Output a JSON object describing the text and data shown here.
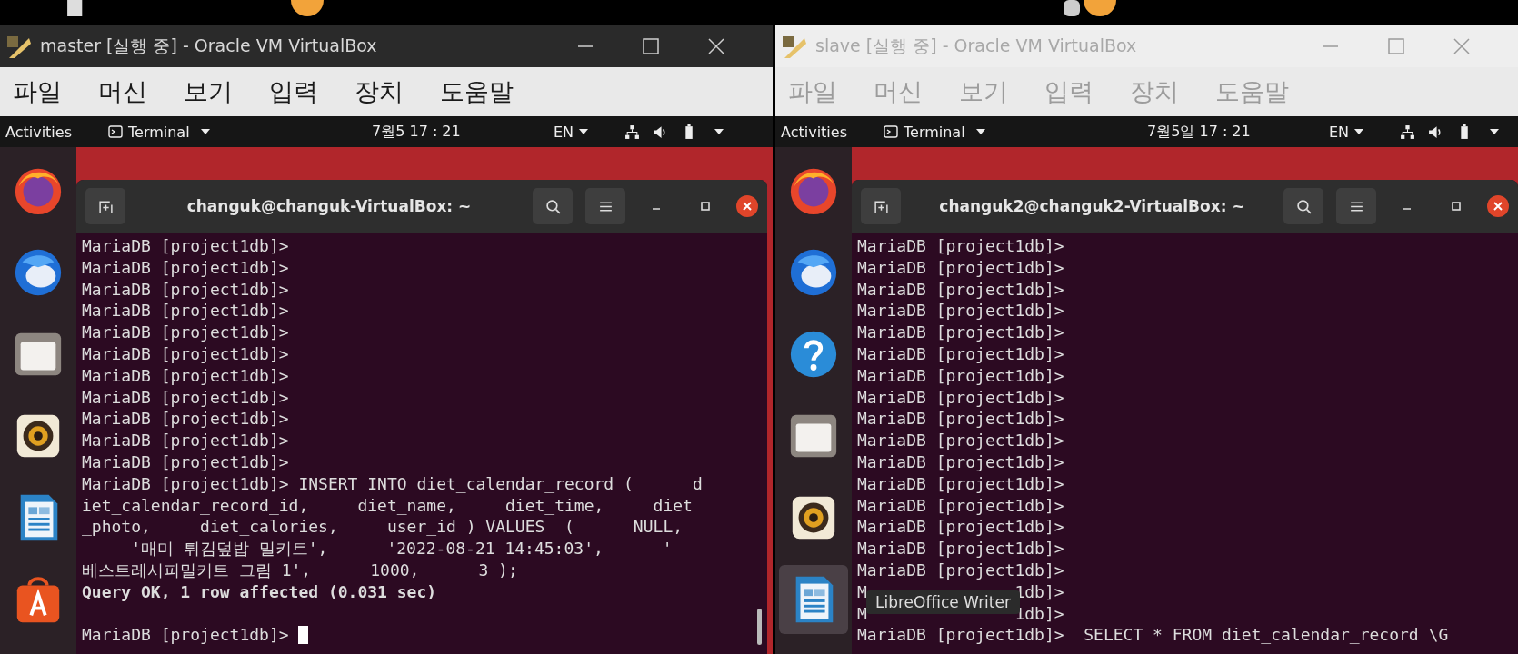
{
  "windows": [
    {
      "title": "master [실행 중] - Oracle VM VirtualBox",
      "active": true,
      "menu": [
        "파일",
        "머신",
        "보기",
        "입력",
        "장치",
        "도움말"
      ],
      "topbar": {
        "activities": "Activities",
        "app": "Terminal",
        "clock": "7월5 17 : 21",
        "language": "EN"
      },
      "dock": [
        {
          "kind": "firefox",
          "selected": false
        },
        {
          "kind": "thunderbird",
          "selected": false
        },
        {
          "kind": "files",
          "selected": false
        },
        {
          "kind": "rhythmbox",
          "selected": false
        },
        {
          "kind": "writer",
          "selected": false
        },
        {
          "kind": "store",
          "selected": false
        }
      ],
      "terminal": {
        "title": "changuk@changuk-VirtualBox: ~",
        "lines": [
          {
            "kind": "input",
            "text": "MariaDB [project1db]>"
          },
          {
            "kind": "input",
            "text": "MariaDB [project1db]>"
          },
          {
            "kind": "input",
            "text": "MariaDB [project1db]>"
          },
          {
            "kind": "input",
            "text": "MariaDB [project1db]>"
          },
          {
            "kind": "input",
            "text": "MariaDB [project1db]>"
          },
          {
            "kind": "input",
            "text": "MariaDB [project1db]>"
          },
          {
            "kind": "input",
            "text": "MariaDB [project1db]>"
          },
          {
            "kind": "input",
            "text": "MariaDB [project1db]>"
          },
          {
            "kind": "input",
            "text": "MariaDB [project1db]>"
          },
          {
            "kind": "input",
            "text": "MariaDB [project1db]>"
          },
          {
            "kind": "input",
            "text": "MariaDB [project1db]>"
          },
          {
            "kind": "input",
            "text": "MariaDB [project1db]> INSERT INTO diet_calendar_record (      d"
          },
          {
            "kind": "input",
            "text": "iet_calendar_record_id,     diet_name,     diet_time,     diet"
          },
          {
            "kind": "input",
            "text": "_photo,     diet_calories,     user_id ) VALUES  (      NULL,"
          },
          {
            "kind": "input",
            "text": "     '매미 튀김덮밥 밀키트',      '2022-08-21 14:45:03',      '"
          },
          {
            "kind": "input",
            "text": "베스트레시피밀키트 그림 1',      1000,      3 );"
          },
          {
            "kind": "output",
            "text": "Query OK, 1 row affected (0.031 sec)"
          }
        ],
        "prompt": {
          "text": "MariaDB [project1db]>",
          "cursor": true
        }
      }
    },
    {
      "title": "slave [실행 중] - Oracle VM VirtualBox",
      "active": false,
      "menu": [
        "파일",
        "머신",
        "보기",
        "입력",
        "장치",
        "도움말"
      ],
      "topbar": {
        "activities": "Activities",
        "app": "Terminal",
        "clock": "7월5일 17 : 21",
        "language": "EN"
      },
      "dock": [
        {
          "kind": "firefox",
          "selected": false
        },
        {
          "kind": "thunderbird",
          "selected": false
        },
        {
          "kind": "help",
          "selected": false
        },
        {
          "kind": "files",
          "selected": false
        },
        {
          "kind": "rhythmbox",
          "selected": false
        },
        {
          "kind": "writer",
          "selected": true
        }
      ],
      "terminal": {
        "title": "changuk2@changuk2-VirtualBox: ~",
        "lines": [
          {
            "kind": "input",
            "text": "MariaDB [project1db]>"
          },
          {
            "kind": "input",
            "text": "MariaDB [project1db]>"
          },
          {
            "kind": "input",
            "text": "MariaDB [project1db]>"
          },
          {
            "kind": "input",
            "text": "MariaDB [project1db]>"
          },
          {
            "kind": "input",
            "text": "MariaDB [project1db]>"
          },
          {
            "kind": "input",
            "text": "MariaDB [project1db]>"
          },
          {
            "kind": "input",
            "text": "MariaDB [project1db]>"
          },
          {
            "kind": "input",
            "text": "MariaDB [project1db]>"
          },
          {
            "kind": "input",
            "text": "MariaDB [project1db]>"
          },
          {
            "kind": "input",
            "text": "MariaDB [project1db]>"
          },
          {
            "kind": "input",
            "text": "MariaDB [project1db]>"
          },
          {
            "kind": "input",
            "text": "MariaDB [project1db]>"
          },
          {
            "kind": "input",
            "text": "MariaDB [project1db]>"
          },
          {
            "kind": "input",
            "text": "MariaDB [project1db]>"
          },
          {
            "kind": "input",
            "text": "MariaDB [project1db]>"
          },
          {
            "kind": "input",
            "text": "MariaDB [project1db]>"
          },
          {
            "kind": "covered",
            "start": "M",
            "end": "1db]>"
          },
          {
            "kind": "covered",
            "start": "M",
            "end": "1db]>"
          },
          {
            "kind": "input",
            "text": "MariaDB [project1db]>  SELECT * FROM diet_calendar_record \\G"
          }
        ]
      },
      "tooltip": "LibreOffice Writer"
    }
  ]
}
